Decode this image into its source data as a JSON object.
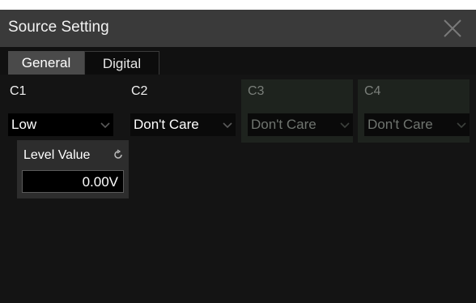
{
  "dialog": {
    "title": "Source Setting",
    "close_icon": "close-icon"
  },
  "tabs": [
    {
      "label": "General",
      "active": true
    },
    {
      "label": "Digital",
      "active": false
    }
  ],
  "channels": [
    {
      "label": "C1",
      "value": "Low",
      "enabled": true
    },
    {
      "label": "C2",
      "value": "Don't Care",
      "enabled": true
    },
    {
      "label": "C3",
      "value": "Don't Care",
      "enabled": false
    },
    {
      "label": "C4",
      "value": "Don't Care",
      "enabled": false
    }
  ],
  "level": {
    "label": "Level Value",
    "value": "0.00V",
    "icon": "refresh-icon"
  },
  "colors": {
    "background": "#040404",
    "titlebar": "#3a3a3a",
    "active_tab": "#4a4a4a",
    "disabled_channel": "#1e231e"
  }
}
